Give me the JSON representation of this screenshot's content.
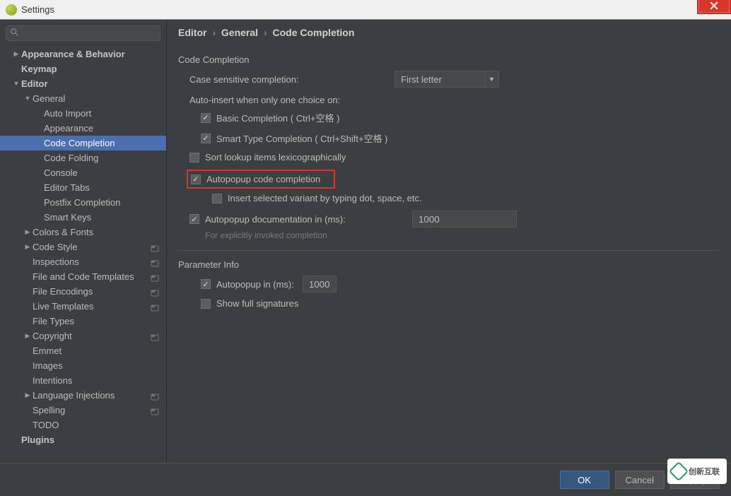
{
  "window": {
    "title": "Settings"
  },
  "search": {
    "placeholder": ""
  },
  "sidebar": {
    "items": [
      {
        "label": "Appearance & Behavior",
        "indent": 0,
        "arrow": "right",
        "bold": true
      },
      {
        "label": "Keymap",
        "indent": 0,
        "arrow": "",
        "bold": true
      },
      {
        "label": "Editor",
        "indent": 0,
        "arrow": "down",
        "bold": true
      },
      {
        "label": "General",
        "indent": 1,
        "arrow": "down",
        "bold": false
      },
      {
        "label": "Auto Import",
        "indent": 2,
        "arrow": "",
        "bold": false
      },
      {
        "label": "Appearance",
        "indent": 2,
        "arrow": "",
        "bold": false
      },
      {
        "label": "Code Completion",
        "indent": 2,
        "arrow": "",
        "bold": false,
        "selected": true
      },
      {
        "label": "Code Folding",
        "indent": 2,
        "arrow": "",
        "bold": false
      },
      {
        "label": "Console",
        "indent": 2,
        "arrow": "",
        "bold": false
      },
      {
        "label": "Editor Tabs",
        "indent": 2,
        "arrow": "",
        "bold": false
      },
      {
        "label": "Postfix Completion",
        "indent": 2,
        "arrow": "",
        "bold": false
      },
      {
        "label": "Smart Keys",
        "indent": 2,
        "arrow": "",
        "bold": false
      },
      {
        "label": "Colors & Fonts",
        "indent": 1,
        "arrow": "right",
        "bold": false
      },
      {
        "label": "Code Style",
        "indent": 1,
        "arrow": "right",
        "bold": false,
        "opt": true
      },
      {
        "label": "Inspections",
        "indent": 1,
        "arrow": "",
        "bold": false,
        "opt": true
      },
      {
        "label": "File and Code Templates",
        "indent": 1,
        "arrow": "",
        "bold": false,
        "opt": true
      },
      {
        "label": "File Encodings",
        "indent": 1,
        "arrow": "",
        "bold": false,
        "opt": true
      },
      {
        "label": "Live Templates",
        "indent": 1,
        "arrow": "",
        "bold": false,
        "opt": true
      },
      {
        "label": "File Types",
        "indent": 1,
        "arrow": "",
        "bold": false
      },
      {
        "label": "Copyright",
        "indent": 1,
        "arrow": "right",
        "bold": false,
        "opt": true
      },
      {
        "label": "Emmet",
        "indent": 1,
        "arrow": "",
        "bold": false
      },
      {
        "label": "Images",
        "indent": 1,
        "arrow": "",
        "bold": false
      },
      {
        "label": "Intentions",
        "indent": 1,
        "arrow": "",
        "bold": false
      },
      {
        "label": "Language Injections",
        "indent": 1,
        "arrow": "right",
        "bold": false,
        "opt": true
      },
      {
        "label": "Spelling",
        "indent": 1,
        "arrow": "",
        "bold": false,
        "opt": true
      },
      {
        "label": "TODO",
        "indent": 1,
        "arrow": "",
        "bold": false
      },
      {
        "label": "Plugins",
        "indent": 0,
        "arrow": "",
        "bold": true
      }
    ]
  },
  "breadcrumb": {
    "p1": "Editor",
    "p2": "General",
    "p3": "Code Completion"
  },
  "sections": {
    "s1": {
      "header": "Code Completion",
      "case_label": "Case sensitive completion:",
      "case_value": "First letter",
      "auto_insert_header": "Auto-insert when only one choice on:",
      "basic": "Basic Completion ( Ctrl+空格 )",
      "smart": "Smart Type Completion ( Ctrl+Shift+空格 )",
      "sort": "Sort lookup items lexicographically",
      "autopopup": "Autopopup code completion",
      "insert_sel": "Insert selected variant by typing dot, space, etc.",
      "autodoc_label": "Autopopup documentation in (ms):",
      "autodoc_value": "1000",
      "autodoc_hint": "For explicitly invoked completion"
    },
    "s2": {
      "header": "Parameter Info",
      "autopopup_label": "Autopopup in (ms):",
      "autopopup_value": "1000",
      "show_full": "Show full signatures"
    }
  },
  "buttons": {
    "ok": "OK",
    "cancel": "Cancel",
    "apply": "Apply"
  },
  "watermark": "创新互联"
}
